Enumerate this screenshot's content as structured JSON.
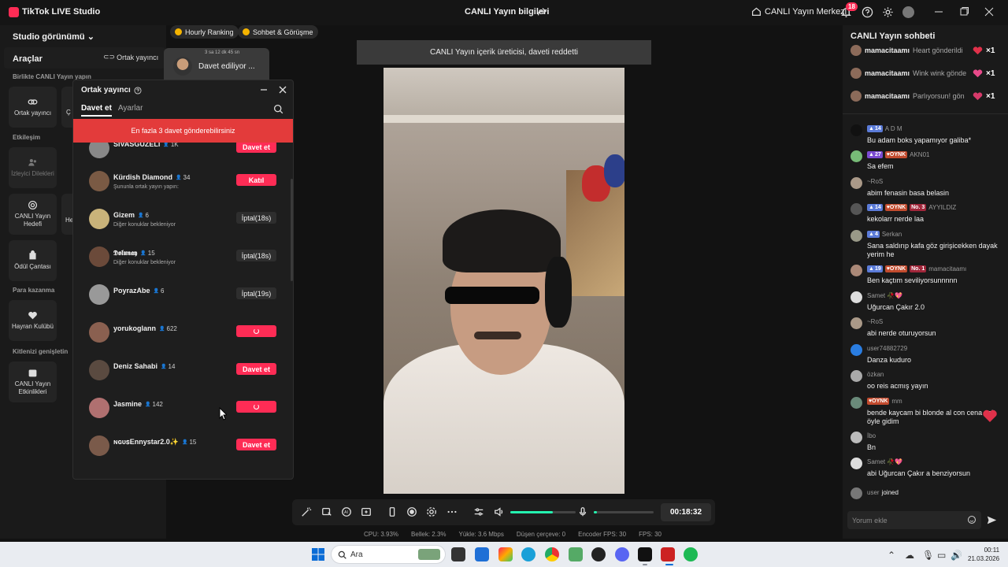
{
  "titlebar": {
    "app_name": "TikTok LIVE Studio",
    "center_title": "CANLI Yayın bilgileri",
    "center_link": "CANLI Yayın Merkezi",
    "notification_count": "18"
  },
  "left": {
    "studio_view": "Studio görünümü",
    "tools_title": "Araçlar",
    "cohost_link": "Ortak yayıncı",
    "sections": {
      "together": "Birlikte CANLI Yayın yapın",
      "engagement": "Etkileşim",
      "monetize": "Para kazanma",
      "grow": "Kitlenizi genişletin"
    },
    "tools": {
      "cohost": "Ortak yayıncı",
      "partial": "Ç",
      "viewer_requests": "İzleyici Dilekleri",
      "live_goal": "CANLI Yayın Hedefi",
      "partial2": "He",
      "reward_bag": "Ödül Çantası",
      "fan_club": "Hayran Kulübü",
      "live_events": "CANLI Yayın Etkinlikleri"
    }
  },
  "pills": {
    "hourly": "Hourly Ranking",
    "chat": "Sohbet & Görüşme"
  },
  "inviting": {
    "top": "3 sa 12 dk 45 sn",
    "text": "Davet ediliyor ..."
  },
  "cohost_panel": {
    "title": "Ortak yayıncı",
    "tab_invite": "Davet et",
    "tab_settings": "Ayarlar",
    "alert": "En fazla 3 davet gönderebilirsiniz",
    "rows": [
      {
        "name": "SIVASGÜZELİ",
        "count": "1K",
        "sub": "",
        "button": "Davet et",
        "state": "red"
      },
      {
        "name": "Kürdish Diamond",
        "count": "34",
        "sub": "Şununla ortak yayın yapın:",
        "button": "Katıl",
        "state": "red"
      },
      {
        "name": "Gizem",
        "count": "6",
        "sub": "Diğer konuklar bekleniyor",
        "button": "İptal(18s)",
        "state": "gray"
      },
      {
        "name": "𝕯𝖔𝖑𝖚𝖓𝖆𝖞",
        "count": "15",
        "sub": "Diğer konuklar bekleniyor",
        "button": "İptal(18s)",
        "state": "gray"
      },
      {
        "name": "PoyrazAbe",
        "count": "6",
        "sub": "",
        "button": "İptal(19s)",
        "state": "gray"
      },
      {
        "name": "yorukoglann",
        "count": "622",
        "sub": "",
        "button": "",
        "state": "spinner"
      },
      {
        "name": "Deniz Sahabi",
        "count": "14",
        "sub": "",
        "button": "Davet et",
        "state": "red"
      },
      {
        "name": "Jasmine",
        "count": "142",
        "sub": "",
        "button": "",
        "state": "spinner"
      },
      {
        "name": "ɴɢᴜꜱEnnystar2.0✨",
        "count": "15",
        "sub": "",
        "button": "Davet et",
        "state": "red"
      }
    ]
  },
  "banner": "CANLI Yayın içerik üreticisi, daveti reddetti",
  "controls": {
    "timer": "00:18:32",
    "volume_level": 0.65,
    "mic_level": 0.05
  },
  "stats": {
    "cpu": "CPU: 3.93%",
    "memory": "Bellek: 2.3%",
    "upload": "Yükle: 3.6 Mbps",
    "dropped": "Düşen çerçeve: 0",
    "encoder_fps": "Encoder FPS: 30",
    "fps": "FPS: 30"
  },
  "chat": {
    "title": "CANLI Yayın sohbeti",
    "gifts": [
      {
        "name": "mamacitaamı",
        "text": "Heart gönderildi",
        "count": "×1"
      },
      {
        "name": "mamacitaamı",
        "text": "Wink wink gönde",
        "count": "×1"
      },
      {
        "name": "mamacitaamı",
        "text": "Parlıyorsun! gön",
        "count": "×1"
      }
    ],
    "messages": [
      {
        "lvl": "14",
        "fan": "",
        "rank": "",
        "user": "A D M",
        "text": "Bu adam boks yapamıyor galiba*"
      },
      {
        "lvl": "27",
        "fan": "OYNK",
        "rank": "",
        "user": "AKN01",
        "text": "Sa efem"
      },
      {
        "lvl": "",
        "fan": "",
        "rank": "",
        "user": "~RoS",
        "text": "abim fenasin basa belasin"
      },
      {
        "lvl": "14",
        "fan": "OYNK",
        "rank": "No. 3",
        "user": "AYYILDIZ",
        "text": "kekolarr nerde laa"
      },
      {
        "lvl": "4",
        "fan": "",
        "rank": "",
        "user": "Serkan",
        "text": "Sana saldırıp kafa göz girişicekken dayak yerim he"
      },
      {
        "lvl": "19",
        "fan": "OYNK",
        "rank": "No. 1",
        "user": "mamacitaamı",
        "text": "Ben kaçtım seviliyorsunnnnn"
      },
      {
        "lvl": "",
        "fan": "",
        "rank": "",
        "user": "Samet 🥀💖",
        "text": "Uğurcan Çakır 2.0"
      },
      {
        "lvl": "",
        "fan": "",
        "rank": "",
        "user": "~RoS",
        "text": "abi nerde oturuyorsun"
      },
      {
        "lvl": "",
        "fan": "",
        "rank": "",
        "user": "user74882729",
        "text": "Danza kuduro"
      },
      {
        "lvl": "",
        "fan": "",
        "rank": "",
        "user": "özkan",
        "text": "oo reis acmış yayın"
      },
      {
        "lvl": "",
        "fan": "OYNK",
        "rank": "",
        "user": "mm",
        "text": "bende kaycam bi blonde al con cena çek öyle gidim"
      },
      {
        "lvl": "",
        "fan": "",
        "rank": "",
        "user": "İbo",
        "text": "Bn"
      },
      {
        "lvl": "",
        "fan": "",
        "rank": "",
        "user": "Samet 🥀💖",
        "text": "abi Uğurcan Çakır a benziyorsun"
      }
    ],
    "joined_user": "user",
    "joined_text": "joined",
    "input_placeholder": "Yorum ekle"
  },
  "taskbar": {
    "search": "Ara",
    "time": "00:11",
    "date": "21.03.2026"
  },
  "colors": {
    "accent": "#fe2c55",
    "alert": "#e33b3b",
    "volume": "#25f4b0",
    "background": "#121212"
  }
}
